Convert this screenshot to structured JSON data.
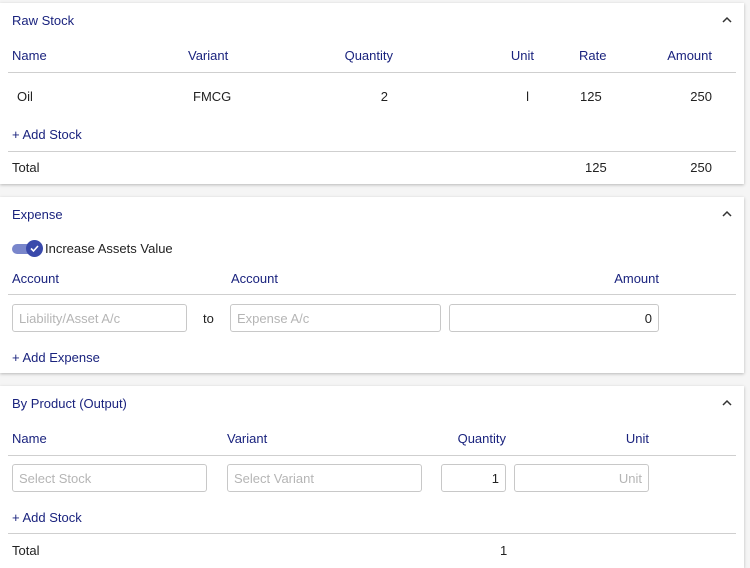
{
  "raw_stock": {
    "title": "Raw Stock",
    "headers": [
      "Name",
      "Variant",
      "Quantity",
      "Unit",
      "Rate",
      "Amount"
    ],
    "rows": [
      {
        "name": "Oil",
        "variant": "FMCG",
        "quantity": "2",
        "unit": "l",
        "rate": "125",
        "amount": "250"
      }
    ],
    "add_label": "+ Add Stock",
    "total_label": "Total",
    "total_rate": "125",
    "total_amount": "250"
  },
  "expense": {
    "title": "Expense",
    "toggle_label": "Increase Assets Value",
    "headers": [
      "Account",
      "Account",
      "Amount"
    ],
    "from_placeholder": "Liability/Asset A/c",
    "to_label": "to",
    "to_placeholder": "Expense A/c",
    "amount_value": "0",
    "add_label": "+ Add Expense"
  },
  "by_product": {
    "title": "By Product (Output)",
    "headers": [
      "Name",
      "Variant",
      "Quantity",
      "Unit"
    ],
    "stock_placeholder": "Select Stock",
    "variant_placeholder": "Select Variant",
    "quantity_value": "1",
    "unit_placeholder": "Unit",
    "add_label": "+ Add Stock",
    "total_label": "Total",
    "total_quantity": "1"
  },
  "colors": {
    "accent": "#1a237e",
    "toggle": "#3949ab"
  }
}
